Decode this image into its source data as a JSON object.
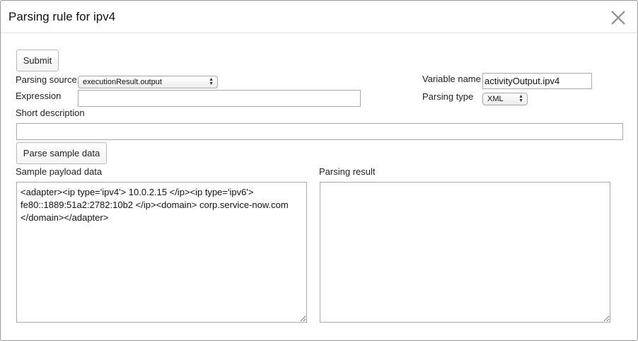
{
  "dialog": {
    "title": "Parsing rule for ipv4",
    "close_icon": "close-icon"
  },
  "form": {
    "submit_label": "Submit",
    "parsing_source_label": "Parsing source",
    "parsing_source_value": "executionResult.output",
    "expression_label": "Expression",
    "expression_value": "",
    "variable_name_label": "Variable name",
    "variable_name_value": "activityOutput.ipv4",
    "parsing_type_label": "Parsing type",
    "parsing_type_value": "XML",
    "short_description_label": "Short description",
    "short_description_value": "",
    "parse_sample_label": "Parse sample data",
    "sample_payload_label": "Sample payload data",
    "sample_payload_value": "<adapter><ip type='ipv4'> 10.0.2.15 </ip><ip type='ipv6'> fe80::1889:51a2:2782:10b2 </ip><domain> corp.service-now.com </domain></adapter>",
    "parsing_result_label": "Parsing result",
    "parsing_result_value": ""
  }
}
